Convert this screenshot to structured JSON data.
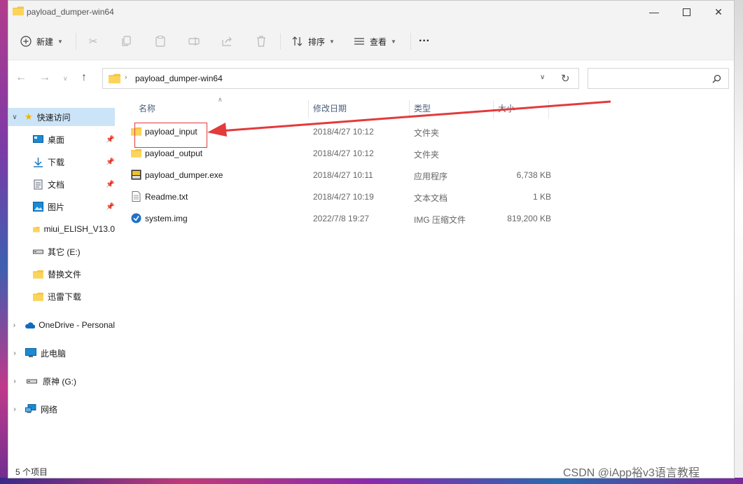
{
  "window": {
    "title": "payload_dumper-win64"
  },
  "toolbar": {
    "new_label": "新建",
    "sort_label": "排序",
    "view_label": "查看",
    "more_label": "···"
  },
  "address": {
    "path": "payload_dumper-win64"
  },
  "search": {
    "placeholder": ""
  },
  "nav": {
    "quick_access": "快速访问",
    "items": [
      {
        "label": "桌面",
        "icon": "desktop-icon",
        "pinned": true
      },
      {
        "label": "下载",
        "icon": "download-icon",
        "pinned": true
      },
      {
        "label": "文档",
        "icon": "document-icon",
        "pinned": true
      },
      {
        "label": "图片",
        "icon": "picture-icon",
        "pinned": true
      },
      {
        "label": "miui_ELISH_V13.0",
        "icon": "folder-icon",
        "pinned": false
      },
      {
        "label": "其它 (E:)",
        "icon": "drive-icon",
        "pinned": false
      },
      {
        "label": "替换文件",
        "icon": "folder-icon",
        "pinned": false
      },
      {
        "label": "迅雷下载",
        "icon": "folder-icon",
        "pinned": false
      }
    ],
    "onedrive": "OneDrive - Personal",
    "this_pc": "此电脑",
    "drive_g": "原神 (G:)",
    "network": "网络"
  },
  "columns": {
    "name": "名称",
    "date": "修改日期",
    "type": "类型",
    "size": "大小"
  },
  "files": [
    {
      "name": "payload_input",
      "date": "2018/4/27 10:12",
      "type": "文件夹",
      "size": "",
      "icon": "folder-icon"
    },
    {
      "name": "payload_output",
      "date": "2018/4/27 10:12",
      "type": "文件夹",
      "size": "",
      "icon": "folder-icon"
    },
    {
      "name": "payload_dumper.exe",
      "date": "2018/4/27 10:11",
      "type": "应用程序",
      "size": "6,738 KB",
      "icon": "exe-icon"
    },
    {
      "name": "Readme.txt",
      "date": "2018/4/27 10:19",
      "type": "文本文档",
      "size": "1 KB",
      "icon": "text-file-icon"
    },
    {
      "name": "system.img",
      "date": "2022/7/8 19:27",
      "type": "IMG 压缩文件",
      "size": "819,200 KB",
      "icon": "img-file-icon"
    }
  ],
  "status": {
    "count": "5 个项目"
  },
  "watermark": "CSDN @iApp裕v3语言教程",
  "colors": {
    "accent": "#0067c0",
    "folder": "#f6c343",
    "annotation": "#e23b3b",
    "selected": "#cce4f7"
  }
}
